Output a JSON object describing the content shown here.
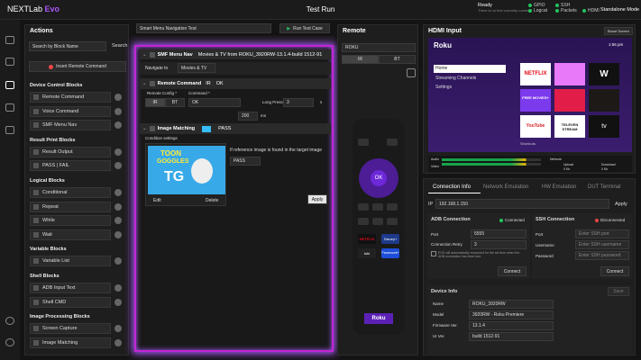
{
  "app": {
    "logo": "NEXTLab",
    "logo_accent": "Evo",
    "title": "Test Run",
    "ready": "Ready",
    "ready_sub": "There is no test currently running.",
    "status": [
      "SSH",
      "Logcat",
      "Packets",
      "HDMI"
    ],
    "status_pre": [
      "GPIO",
      "SSH"
    ],
    "mode": "Standalone Mode"
  },
  "actions": {
    "title": "Actions",
    "menu_select": "Smart Menu Navigation Test",
    "run_btn": "Run Test Case",
    "search_sel": "Search by Block Name",
    "search_btn": "Search",
    "insert_btn": "Insert Remote Command",
    "groups": [
      {
        "title": "Device Control Blocks",
        "items": [
          "Remote Command",
          "Voice Command",
          "SMF Menu Nav"
        ]
      },
      {
        "title": "Result Print Blocks",
        "items": [
          "Result Output",
          "PASS | FAIL"
        ]
      },
      {
        "title": "Logical Blocks",
        "items": [
          "Conditional",
          "Repeat",
          "While",
          "Wait"
        ]
      },
      {
        "title": "Variable Blocks",
        "items": [
          "Variable List"
        ]
      },
      {
        "title": "Shell Blocks",
        "items": [
          "ADB Input Text",
          "Shell CMD"
        ]
      },
      {
        "title": "Image Processing Blocks",
        "items": [
          "Screen Capture",
          "Image Matching"
        ]
      }
    ]
  },
  "canvas": {
    "smf_label": "SMF Menu Nav",
    "smf_desc": "Movies & TV from ROKU_3920RW-13.1.4-build 1512-91",
    "nav_to": "Navigate to",
    "nav_value": "Movies & TV",
    "rc_title": "Remote Command",
    "rc_ir": "IR",
    "rc_ok": "OK",
    "rc_config": "Remote Config *",
    "rc_command": "Command *",
    "rc_ir_btn": "IR",
    "rc_bt_btn": "BT",
    "rc_cmd_val": "OK",
    "long_press": "Long Press",
    "long_val": "3",
    "long_unit": "s",
    "ms_val": "200",
    "ms_unit": "ms",
    "im_title": "Image Matching",
    "im_pass": "PASS",
    "cond": "Condition settings",
    "cond_text": "If reference image is found in the target image",
    "cond_sel": "PASS",
    "apply": "Apply",
    "edit": "Edit",
    "delete": "Delete",
    "thumb_line1": "TOON",
    "thumb_line2": "GOGGLES",
    "thumb_tg": "TG"
  },
  "remote": {
    "title": "Remote",
    "device": "ROKU",
    "ir": "IR",
    "bt": "BT",
    "ok": "OK",
    "brand": "Roku",
    "apps": [
      "NETFLIX",
      "Disney+",
      "tubi",
      "Paramount+"
    ]
  },
  "hdmi": {
    "title": "HDMI Input",
    "boost": "Boost Screen",
    "roku": "Roku",
    "time": "1:56 pm",
    "menu": [
      "Home",
      "Streaming Channels",
      "Settings"
    ],
    "tiles": [
      "NETFLIX",
      "",
      "",
      "",
      "FREE MOVIES+",
      "",
      "",
      "YouTube",
      "TELEVEN STREAM",
      "tv"
    ],
    "shortcuts": "Shortcuts",
    "audio": "Audio",
    "video": "Video",
    "network": "Network",
    "upload": "Upload",
    "download": "Download",
    "up_val": "0 Kb",
    "down_val": "0 Kb"
  },
  "conn": {
    "tabs": [
      "Connection Info",
      "Network Emulation",
      "HW Emulation",
      "DUT Terminal"
    ],
    "ip_label": "IP",
    "ip_value": "192.168.1.150",
    "apply": "Apply",
    "adb": {
      "title": "ADB Connection",
      "status": "Connected",
      "port_label": "Port",
      "port_value": "5555",
      "retry_label": "Connection Retry",
      "retry_value": "3",
      "note": "EVO will automatically reconnect for the set time when the ADB connection has been lost.",
      "connect": "Connect"
    },
    "ssh": {
      "title": "SSH Connection",
      "status": "Disconnected",
      "port_label": "Port",
      "port_ph": "Enter SSH port",
      "user_label": "Username",
      "user_ph": "Enter SSH username",
      "pass_label": "Password",
      "pass_ph": "Enter SSH password",
      "connect": "Connect"
    },
    "device": {
      "title": "Device Info",
      "save": "Save",
      "rows": [
        [
          "Name",
          "ROKU_3920RW"
        ],
        [
          "Model",
          "3920RW - Roku Premiere"
        ],
        [
          "Firmware Ver.",
          "13.1.4"
        ],
        [
          "UI Ver.",
          "build 1512-91"
        ]
      ]
    }
  },
  "colors": {
    "accent": "#a855f7",
    "green": "#22c55e",
    "red": "#ef4444"
  }
}
